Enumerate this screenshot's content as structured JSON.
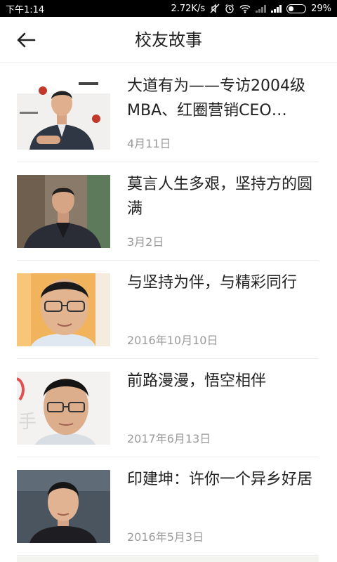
{
  "status_bar": {
    "time": "下午1:14",
    "network_speed": "2.72K/s",
    "battery": "29%",
    "icons": [
      "mute-icon",
      "alarm-icon",
      "wifi-icon",
      "signal-icon",
      "battery-icon"
    ]
  },
  "header": {
    "title": "校友故事",
    "back_icon": "back-arrow-icon"
  },
  "stories": [
    {
      "title": "大道有为——专访2004级MBA、红圈营销CEO…",
      "date": "4月11日"
    },
    {
      "title": "莫言人生多艰，坚持方的圆满",
      "date": "3月2日"
    },
    {
      "title": "与坚持为伴，与精彩同行",
      "date": "2016年10月10日"
    },
    {
      "title": "前路漫漫，悟空相伴",
      "date": "2017年6月13日"
    },
    {
      "title": "印建坤：许你一个异乡好居",
      "date": "2016年5月3日"
    }
  ],
  "colors": {
    "status_bar_bg": "#000000",
    "text_primary": "#222222",
    "text_secondary": "#9a9a9a",
    "divider": "#ebebeb"
  }
}
